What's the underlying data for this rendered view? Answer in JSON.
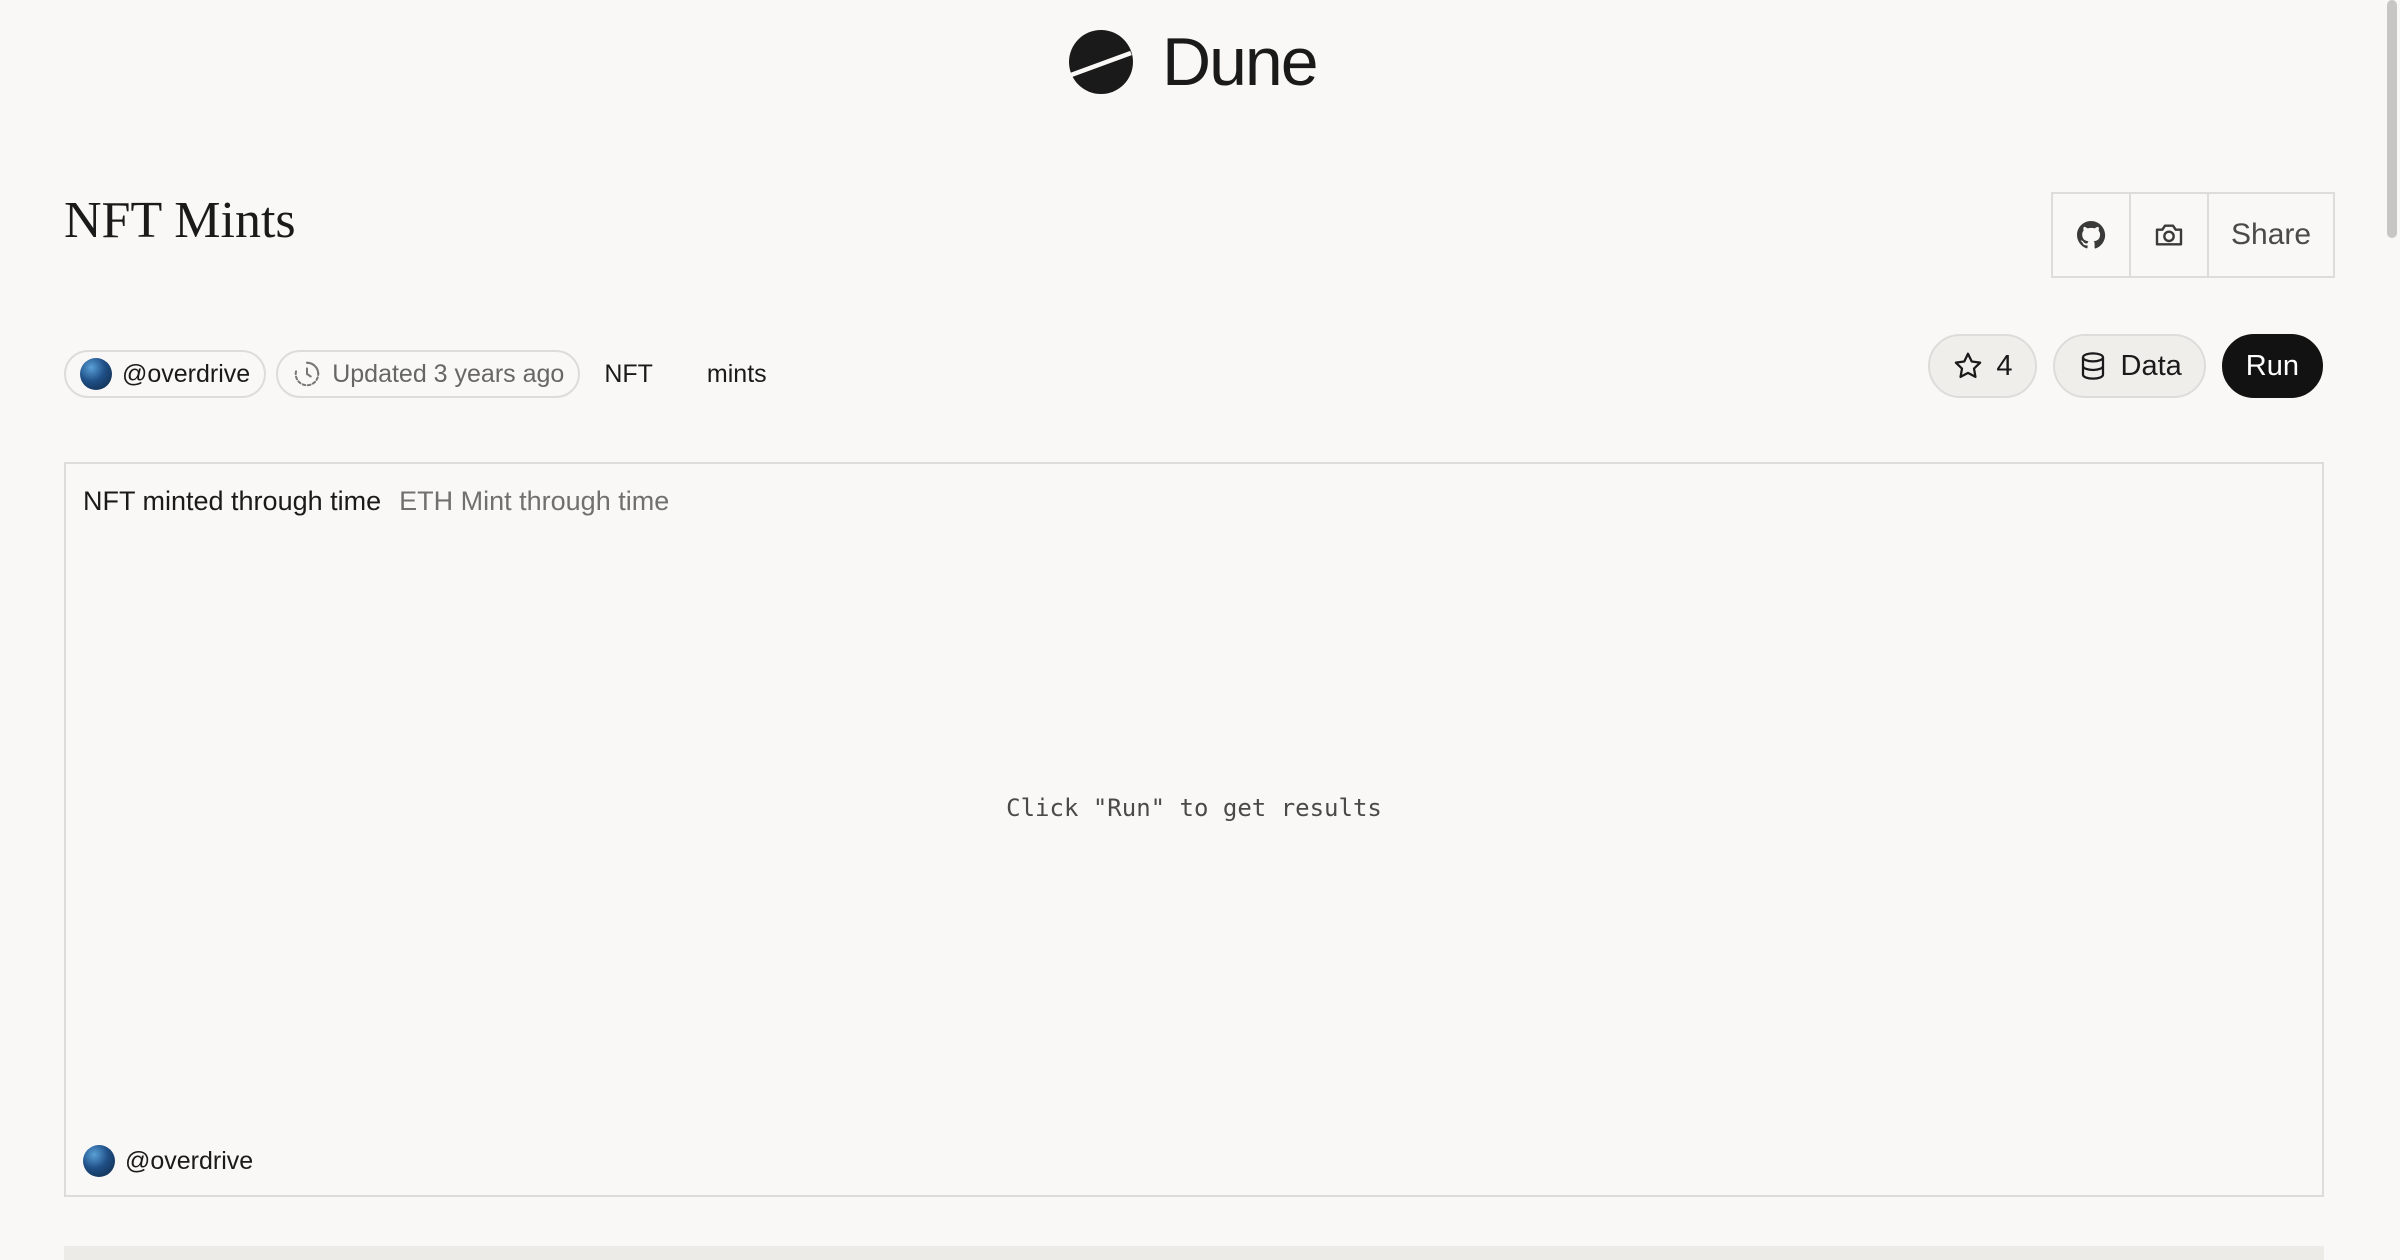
{
  "brand": {
    "name": "Dune"
  },
  "page": {
    "title": "NFT Mints"
  },
  "header_actions": {
    "share_label": "Share",
    "icons": [
      "github-icon",
      "camera-icon"
    ]
  },
  "meta": {
    "author": "@overdrive",
    "updated": "Updated 3 years ago",
    "tags": [
      "NFT",
      "mints"
    ]
  },
  "actions": {
    "star_count": "4",
    "data_label": "Data",
    "run_label": "Run"
  },
  "visualization": {
    "title": "NFT minted through time",
    "subtitle": "ETH Mint through time",
    "empty_message": "Click \"Run\" to get results",
    "author": "@overdrive"
  },
  "colors": {
    "background": "#f9f8f6",
    "border": "#dcdcd8",
    "run_button": "#121212",
    "text": "#1a1a1a"
  }
}
